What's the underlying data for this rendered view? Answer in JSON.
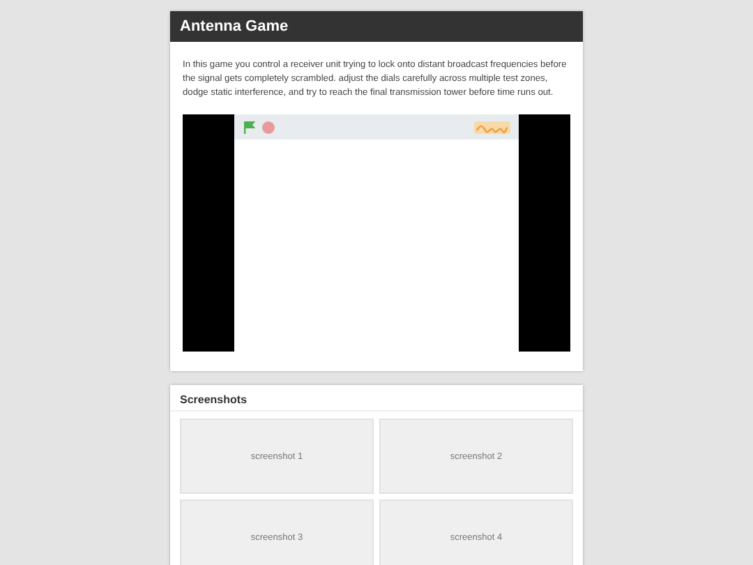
{
  "game": {
    "title": "Antenna Game",
    "description": "In this game you control a receiver unit trying to lock onto distant broadcast frequencies before the signal gets completely scrambled. adjust the dials carefully across multiple test zones, dodge static interference, and try to reach the final transmission tower before time runs out."
  },
  "screenshots": {
    "title": "Screenshots",
    "items": [
      {
        "label": "screenshot 1"
      },
      {
        "label": "screenshot 2"
      },
      {
        "label": "screenshot 3"
      },
      {
        "label": "screenshot 4"
      }
    ]
  }
}
